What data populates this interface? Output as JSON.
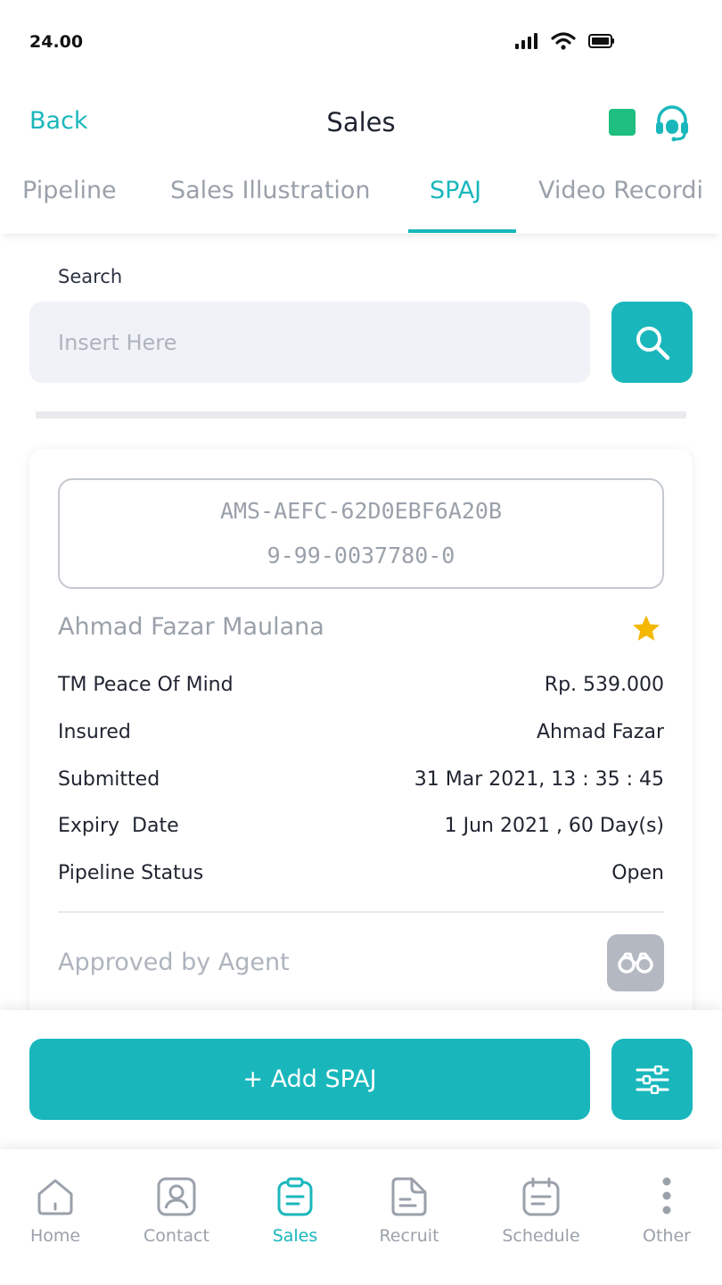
{
  "status_bar": {
    "time": "24.00",
    "icons": [
      "signal-icon",
      "wifi-icon",
      "battery-icon"
    ]
  },
  "header": {
    "back_label": "Back",
    "title": "Sales",
    "icons": [
      "status-square-icon",
      "headset-icon"
    ]
  },
  "tabs": [
    {
      "label": "Pipeline",
      "active": false
    },
    {
      "label": "Sales Illustration",
      "active": false
    },
    {
      "label": "SPAJ",
      "active": true
    },
    {
      "label": "Video Recordi",
      "active": false
    }
  ],
  "search": {
    "label": "Search",
    "placeholder": "Insert Here",
    "value": "",
    "button_icon": "search-icon"
  },
  "card": {
    "id_line1": "AMS-AEFC-62D0EBF6A20B",
    "id_line2": "9-99-0037780-0",
    "holder_name": "Ahmad Fazar Maulana",
    "starred": true,
    "rows": [
      {
        "key": "TM Peace Of Mind",
        "value": "Rp. 539.000"
      },
      {
        "key": "Insured",
        "value": "Ahmad Fazar"
      },
      {
        "key": "Submitted",
        "value": "31 Mar 2021, 13 : 35 : 45"
      },
      {
        "key": "Expiry  Date",
        "value": "1 Jun 2021 , 60 Day(s)"
      },
      {
        "key": "Pipeline Status",
        "value": "Open"
      }
    ],
    "approval_text": "Approved by Agent",
    "approval_icon": "binoculars-icon"
  },
  "actions": {
    "add_label": "+ Add SPAJ",
    "filter_icon": "sliders-icon"
  },
  "bottom_nav": [
    {
      "label": "Home",
      "icon": "home-icon",
      "active": false
    },
    {
      "label": "Contact",
      "icon": "contact-icon",
      "active": false
    },
    {
      "label": "Sales",
      "icon": "sales-icon",
      "active": true
    },
    {
      "label": "Recruit",
      "icon": "recruit-icon",
      "active": false
    },
    {
      "label": "Schedule",
      "icon": "calendar-icon",
      "active": false
    },
    {
      "label": "Other",
      "icon": "more-icon",
      "active": false
    }
  ],
  "colors": {
    "accent": "#19b7bc",
    "status_green": "#1fbf7f",
    "star": "#f5b800",
    "muted_text": "#9aa1ab"
  }
}
